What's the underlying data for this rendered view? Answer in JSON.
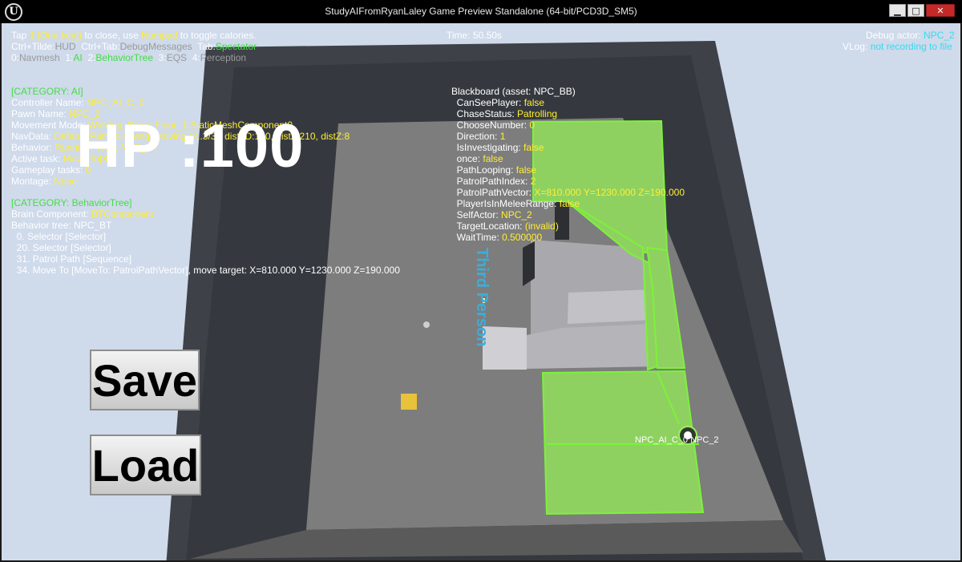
{
  "titlebar": {
    "title": "StudyAIFromRyanLaley Game Preview Standalone (64-bit/PCD3D_SM5)",
    "logo": "U",
    "min": "▁",
    "max": "□",
    "close": "✕"
  },
  "hud": {
    "line1_a": "Tap ",
    "line1_b": "1 [One key])",
    "line1_c": " to close, use ",
    "line1_d": "Numpad",
    "line1_e": " to toggle catories.",
    "line2_a": "Ctrl+Tilde:",
    "line2_b": "HUD",
    "line2_c": "  Ctrl+Tab:",
    "line2_d": "DebugMessages",
    "line2_e": "  Tab:",
    "line2_f": "Spectator",
    "line3_a": "0:",
    "line3_b": "Navmesh",
    "line3_c": "  1:",
    "line3_d": "AI",
    "line3_e": "  2:",
    "line3_f": "BehaviorTree",
    "line3_g": "  3:",
    "line3_h": "EQS",
    "line3_i": "  4:",
    "line3_j": "Perception",
    "time": "Time: 50.50s",
    "debug_actor_label": "Debug actor: ",
    "debug_actor_value": "NPC_2",
    "vlog_label": "VLog: ",
    "vlog_value": "not recording to file"
  },
  "ai": {
    "header": "[CATEGORY: AI]",
    "controller_label": "Controller Name: ",
    "controller_value": "NPC_AI_C_0",
    "pawn_label": "Pawn Name: ",
    "pawn_value": "NPC_2",
    "movement_label": "Movement Mode: ",
    "movement_value": "Walking, Base: Floor_1.StaticMeshComponent0",
    "navdata_label": "NavData: ",
    "navdata_value": "Default, Path following: Moving (2..3/3), dist2D:100, distZ:210, distZ:8",
    "behavior_label": "Behavior: ",
    "behavior_value": "Running, Tree: NPC_BT",
    "active_task_label": "Active task: ",
    "active_task_value": "Move To[34]",
    "gameplay_tasks_label": "Gameplay tasks: ",
    "gameplay_tasks_value": "0",
    "montage_label": "Montage: ",
    "montage_value": "None"
  },
  "bt": {
    "header": "[CATEGORY: BehaviorTree]",
    "brain_label": "Brain Component: ",
    "brain_value": "BTComponent",
    "tree": "Behavior tree: NPC_BT",
    "nodes": [
      "  0. Selector [Selector]",
      "  20. Selector [Selector]",
      "  31. Patrol Path [Sequence]",
      "  34. Move To [MoveTo: PatrolPathVector], move target: X=810.000 Y=1230.000 Z=190.000"
    ]
  },
  "blackboard": {
    "header": "Blackboard (asset: NPC_BB)",
    "keys": [
      {
        "k": "  CanSeePlayer: ",
        "v": "false"
      },
      {
        "k": "  ChaseStatus: ",
        "v": "Patrolling"
      },
      {
        "k": "  ChooseNumber: ",
        "v": "0"
      },
      {
        "k": "  Direction: ",
        "v": "1"
      },
      {
        "k": "  IsInvestigating: ",
        "v": "false"
      },
      {
        "k": "  once: ",
        "v": "false"
      },
      {
        "k": "  PathLooping: ",
        "v": "false"
      },
      {
        "k": "  PatrolPathIndex: ",
        "v": "2"
      },
      {
        "k": "  PatrolPathVector: ",
        "v": "X=810.000 Y=1230.000 Z=190.000"
      },
      {
        "k": "  PlayerIsInMeleeRange: ",
        "v": "false"
      },
      {
        "k": "  SelfActor: ",
        "v": "NPC_2"
      },
      {
        "k": "  TargetLocation: ",
        "v": "(invalid)"
      },
      {
        "k": "  WaitTime: ",
        "v": "0.500000"
      }
    ]
  },
  "overlay": {
    "hp": "HP :100",
    "save": "Save",
    "load": "Load",
    "third_person": "Third Person",
    "npc_label": "NPC_AI_C_0 NPC_2"
  }
}
